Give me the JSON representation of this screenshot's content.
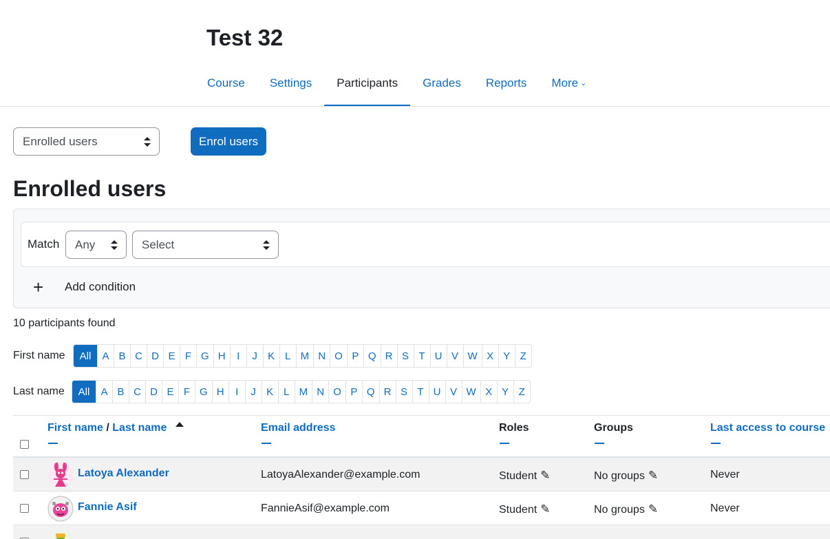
{
  "course": {
    "title": "Test 32"
  },
  "tabs": [
    {
      "label": "Course"
    },
    {
      "label": "Settings"
    },
    {
      "label": "Participants",
      "active": true
    },
    {
      "label": "Grades"
    },
    {
      "label": "Reports"
    },
    {
      "label": "More"
    }
  ],
  "page_select": {
    "value": "Enrolled users"
  },
  "enrol_button": {
    "label": "Enrol users"
  },
  "heading": "Enrolled users",
  "filter": {
    "match_label": "Match",
    "match_value": "Any",
    "type_value": "Select",
    "add_condition_label": "Add condition"
  },
  "participants_count": "10 participants found",
  "initials": {
    "first_label": "First name",
    "last_label": "Last name",
    "all_label": "All",
    "letters": [
      "A",
      "B",
      "C",
      "D",
      "E",
      "F",
      "G",
      "H",
      "I",
      "J",
      "K",
      "L",
      "M",
      "N",
      "O",
      "P",
      "Q",
      "R",
      "S",
      "T",
      "U",
      "V",
      "W",
      "X",
      "Y",
      "Z"
    ]
  },
  "table": {
    "headers": {
      "first_name": "First name",
      "separator": "/",
      "last_name": "Last name",
      "email": "Email address",
      "roles": "Roles",
      "groups": "Groups",
      "last_access": "Last access to course"
    },
    "rows": [
      {
        "name": "Latoya Alexander",
        "email": "LatoyaAlexander@example.com",
        "role": "Student",
        "groups": "No groups",
        "last_access": "Never"
      },
      {
        "name": "Fannie Asif",
        "email": "FannieAsif@example.com",
        "role": "Student",
        "groups": "No groups",
        "last_access": "Never"
      }
    ]
  },
  "colors": {
    "primary": "#0f6cbf",
    "text": "#1d2125",
    "border": "#dee2e6"
  },
  "icons": {
    "sort": "sort-asc-icon",
    "edit": "pencil-icon",
    "add": "plus-icon",
    "dropdown": "chevron-down-icon"
  }
}
